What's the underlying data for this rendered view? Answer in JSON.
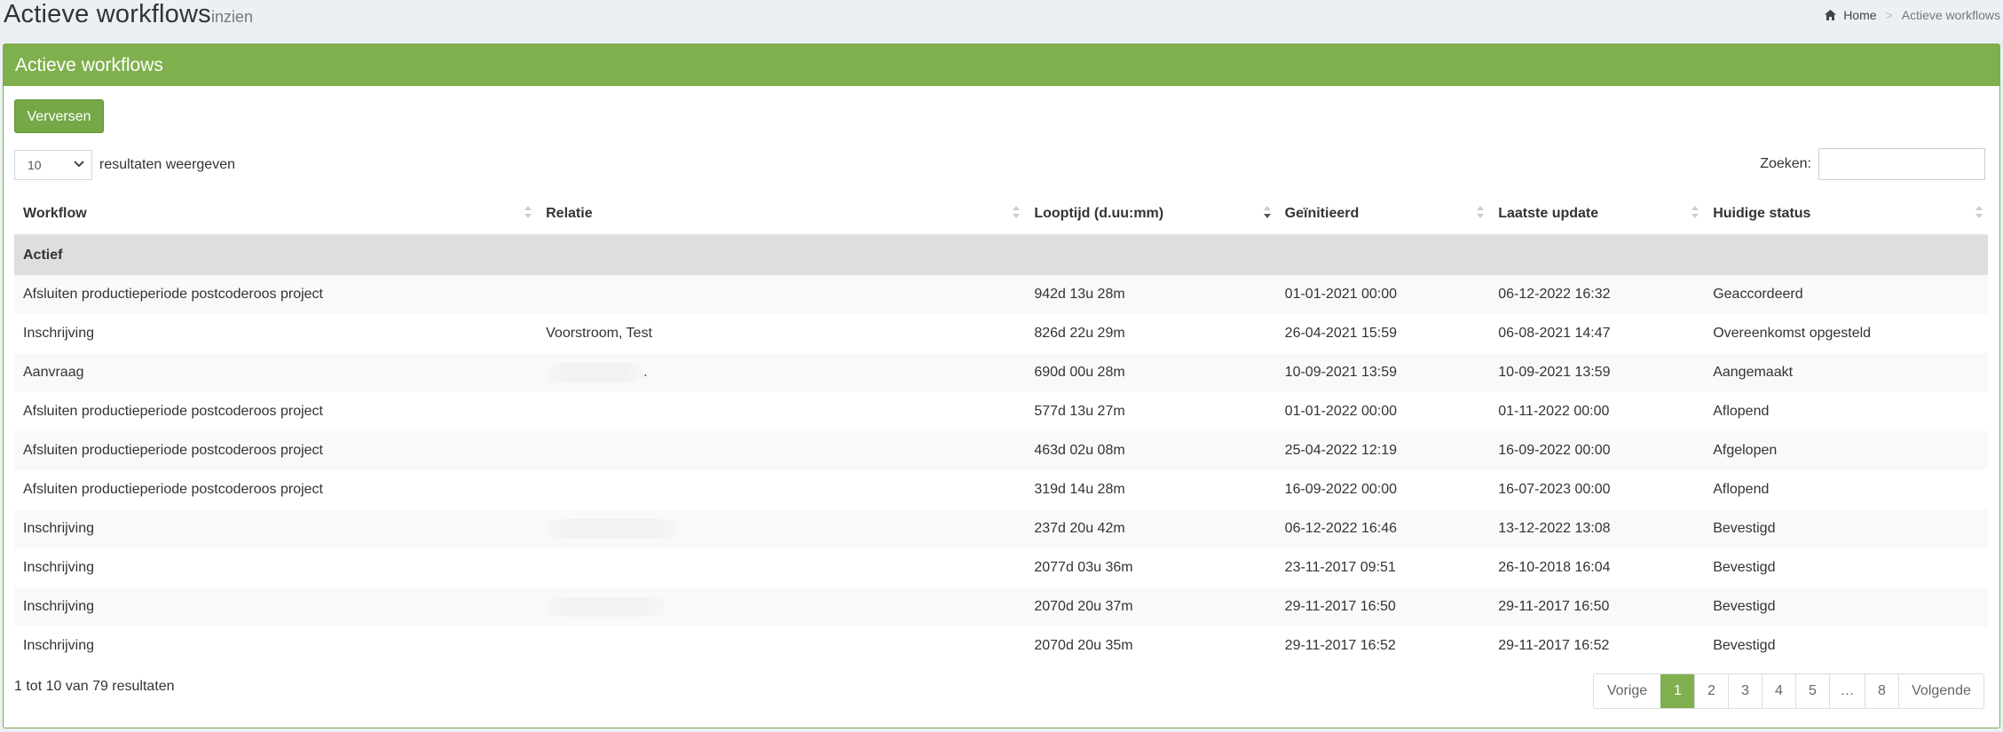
{
  "header": {
    "title": "Actieve workflows",
    "subtitle": "inzien",
    "breadcrumb": {
      "home": "Home",
      "current": "Actieve workflows"
    }
  },
  "box": {
    "title": "Actieve workflows"
  },
  "toolbar": {
    "refresh_label": "Verversen"
  },
  "length_menu": {
    "value": "10",
    "suffix": "resultaten weergeven"
  },
  "search": {
    "label": "Zoeken:",
    "value": ""
  },
  "table": {
    "columns": [
      "Workflow",
      "Relatie",
      "Looptijd (d.uu:mm)",
      "Geïnitieerd",
      "Laatste update",
      "Huidige status"
    ],
    "group_label": "Actief",
    "rows": [
      {
        "workflow": "Afsluiten productieperiode postcoderoos project",
        "relatie": "",
        "looptijd": "942d 13u 28m",
        "geinitieerd": "01-01-2021 00:00",
        "update": "06-12-2022 16:32",
        "status": "Geaccordeerd"
      },
      {
        "workflow": "Inschrijving",
        "relatie": "Voorstroom, Test",
        "looptijd": "826d 22u 29m",
        "geinitieerd": "26-04-2021 15:59",
        "update": "06-08-2021 14:47",
        "status": "Overeenkomst opgesteld"
      },
      {
        "workflow": "Aanvraag",
        "relatie": ".",
        "looptijd": "690d 00u 28m",
        "geinitieerd": "10-09-2021 13:59",
        "update": "10-09-2021 13:59",
        "status": "Aangemaakt"
      },
      {
        "workflow": "Afsluiten productieperiode postcoderoos project",
        "relatie": "",
        "looptijd": "577d 13u 27m",
        "geinitieerd": "01-01-2022 00:00",
        "update": "01-11-2022 00:00",
        "status": "Aflopend"
      },
      {
        "workflow": "Afsluiten productieperiode postcoderoos project",
        "relatie": "",
        "looptijd": "463d 02u 08m",
        "geinitieerd": "25-04-2022 12:19",
        "update": "16-09-2022 00:00",
        "status": "Afgelopen"
      },
      {
        "workflow": "Afsluiten productieperiode postcoderoos project",
        "relatie": "",
        "looptijd": "319d 14u 28m",
        "geinitieerd": "16-09-2022 00:00",
        "update": "16-07-2023 00:00",
        "status": "Aflopend"
      },
      {
        "workflow": "Inschrijving",
        "relatie": "",
        "looptijd": "237d 20u 42m",
        "geinitieerd": "06-12-2022 16:46",
        "update": "13-12-2022 13:08",
        "status": "Bevestigd"
      },
      {
        "workflow": "Inschrijving",
        "relatie": "",
        "looptijd": "2077d 03u 36m",
        "geinitieerd": "23-11-2017 09:51",
        "update": "26-10-2018 16:04",
        "status": "Bevestigd"
      },
      {
        "workflow": "Inschrijving",
        "relatie": "",
        "looptijd": "2070d 20u 37m",
        "geinitieerd": "29-11-2017 16:50",
        "update": "29-11-2017 16:50",
        "status": "Bevestigd"
      },
      {
        "workflow": "Inschrijving",
        "relatie": "",
        "looptijd": "2070d 20u 35m",
        "geinitieerd": "29-11-2017 16:52",
        "update": "29-11-2017 16:52",
        "status": "Bevestigd"
      }
    ]
  },
  "footer": {
    "info": "1 tot 10 van 79 resultaten"
  },
  "pagination": {
    "prev": "Vorige",
    "pages": [
      "1",
      "2",
      "3",
      "4",
      "5",
      "…",
      "8"
    ],
    "active": "1",
    "next": "Volgende"
  },
  "colors": {
    "accent": "#7fb04d",
    "background": "#ecf0f5"
  }
}
